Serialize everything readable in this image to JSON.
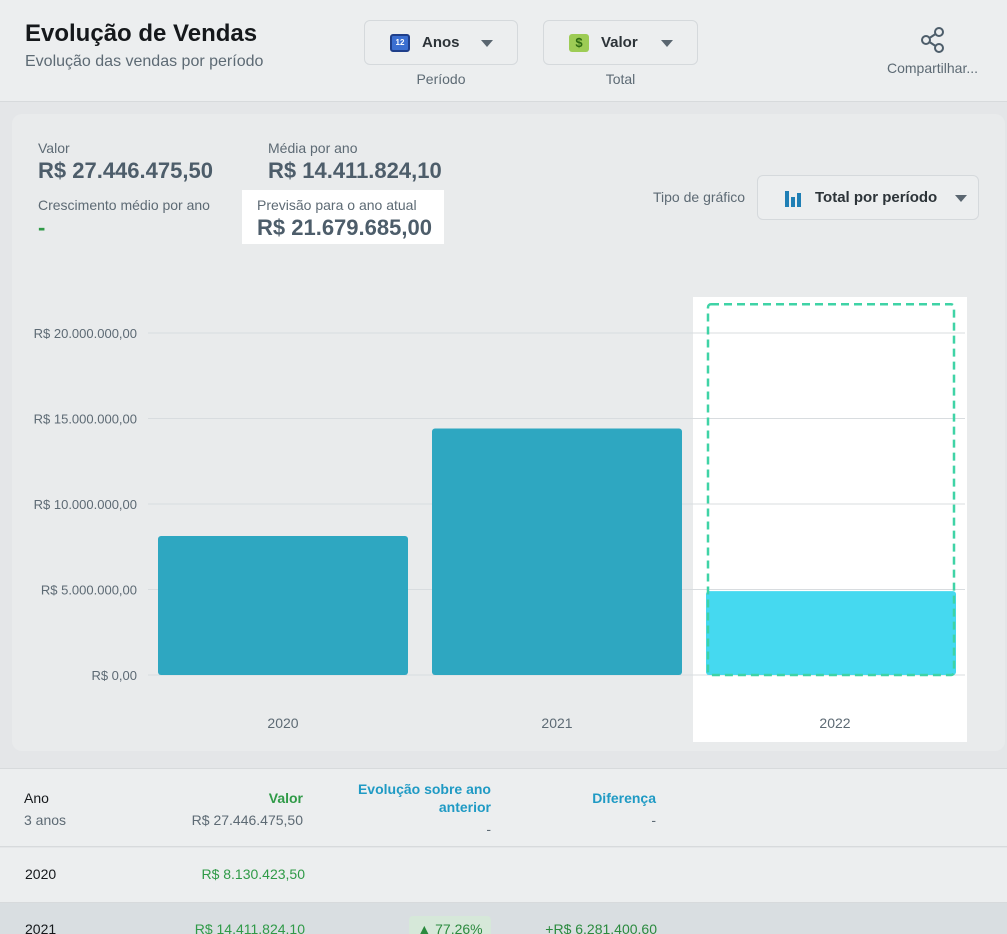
{
  "header": {
    "title": "Evolução de Vendas",
    "subtitle": "Evolução das vendas por período",
    "period_dropdown": {
      "icon": "calendar-icon",
      "icon_text": "12",
      "value": "Anos",
      "caption": "Período"
    },
    "total_dropdown": {
      "icon": "dollar-icon",
      "icon_text": "$",
      "value": "Valor",
      "caption": "Total"
    },
    "share_label": "Compartilhar..."
  },
  "summary": {
    "valor_label": "Valor",
    "valor": "R$ 27.446.475,50",
    "media_label": "Média por ano",
    "media": "R$ 14.411.824,10",
    "crescimento_label": "Crescimento médio por ano",
    "crescimento": "-",
    "previsao_label": "Previsão para o ano atual",
    "previsao": "R$ 21.679.685,00"
  },
  "chart_type": {
    "label": "Tipo de gráfico",
    "value": "Total por período"
  },
  "chart_data": {
    "type": "bar",
    "categories": [
      "2020",
      "2021",
      "2022"
    ],
    "values": [
      8130423.5,
      14411824.1,
      4904227.9
    ],
    "forecast": {
      "category": "2022",
      "value": 21679685.0
    },
    "ylim": [
      0,
      22000000
    ],
    "yticks": [
      0,
      5000000,
      10000000,
      15000000,
      20000000
    ],
    "ytick_labels": [
      "R$ 0,00",
      "R$ 5.000.000,00",
      "R$ 10.000.000,00",
      "R$ 15.000.000,00",
      "R$ 20.000.000,00"
    ],
    "colors": {
      "bar": "#2ea7c1",
      "current": "#45d9f0",
      "forecast_outline": "#3fd3a6"
    },
    "grid": true
  },
  "table": {
    "headers": {
      "ano": "Ano",
      "valor": "Valor",
      "evolucao_line1": "Evolução sobre ano",
      "evolucao_line2": "anterior",
      "diferenca": "Diferença"
    },
    "summary": {
      "ano": "3 anos",
      "valor": "R$ 27.446.475,50",
      "evolucao": "-",
      "diferenca": "-"
    },
    "rows": [
      {
        "ano": "2020",
        "valor": "R$ 8.130.423,50",
        "evolucao": "",
        "diferenca": ""
      },
      {
        "ano": "2021",
        "valor": "R$ 14.411.824,10",
        "evolucao": "▲ 77,26%",
        "diferenca": "+R$ 6.281.400,60"
      }
    ]
  }
}
